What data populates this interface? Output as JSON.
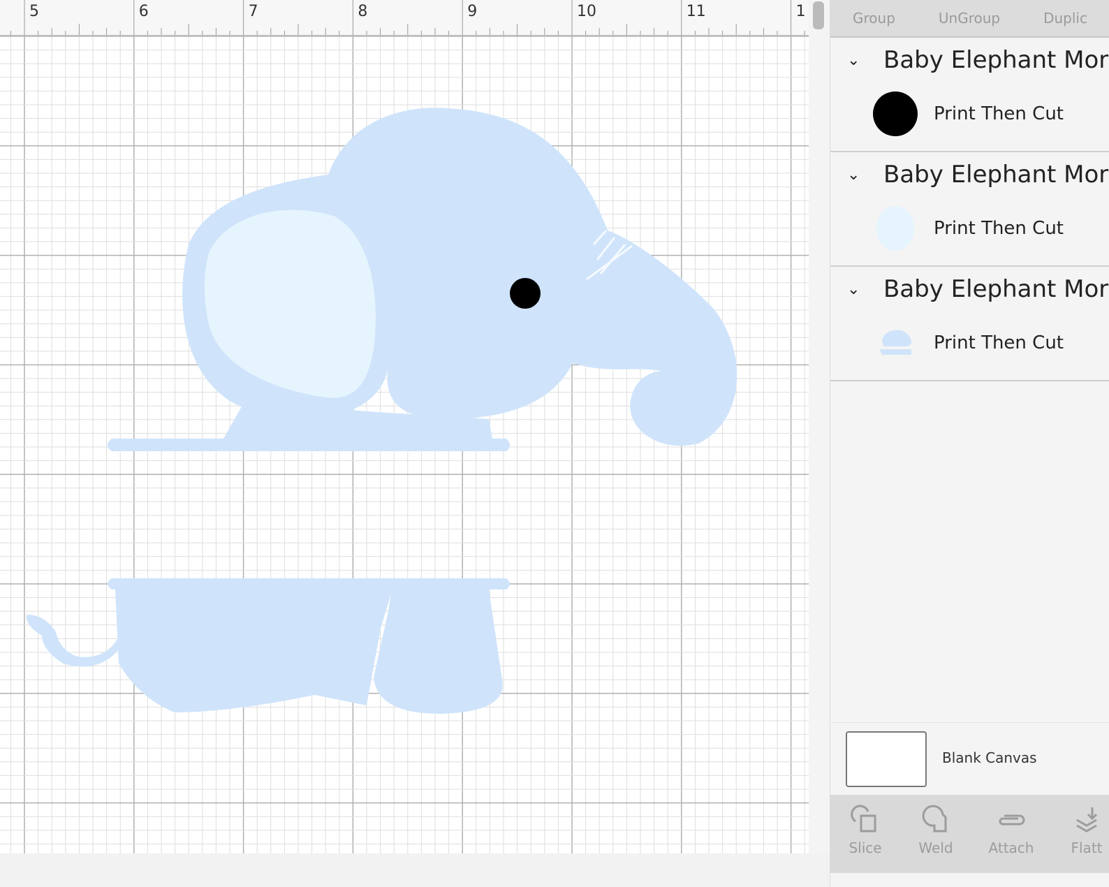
{
  "ruler": {
    "labels": [
      "5",
      "6",
      "7",
      "8",
      "9",
      "10",
      "11",
      "1"
    ]
  },
  "toolbar": {
    "group": "Group",
    "ungroup": "UnGroup",
    "duplicate": "Duplic"
  },
  "layers": [
    {
      "title": "Baby Elephant Mor",
      "layer_label": "Print Then Cut",
      "thumb": "black-circle"
    },
    {
      "title": "Baby Elephant Mor",
      "layer_label": "Print Then Cut",
      "thumb": "light-blue-ear"
    },
    {
      "title": "Baby Elephant Mor",
      "layer_label": "Print Then Cut",
      "thumb": "elephant"
    }
  ],
  "blank_canvas": "Blank Canvas",
  "bottom": {
    "slice": "Slice",
    "weld": "Weld",
    "attach": "Attach",
    "flatten": "Flatt"
  },
  "colors": {
    "elephant_body": "#cfe4fb",
    "elephant_ear": "#e6f4fd",
    "eye": "#000000"
  }
}
